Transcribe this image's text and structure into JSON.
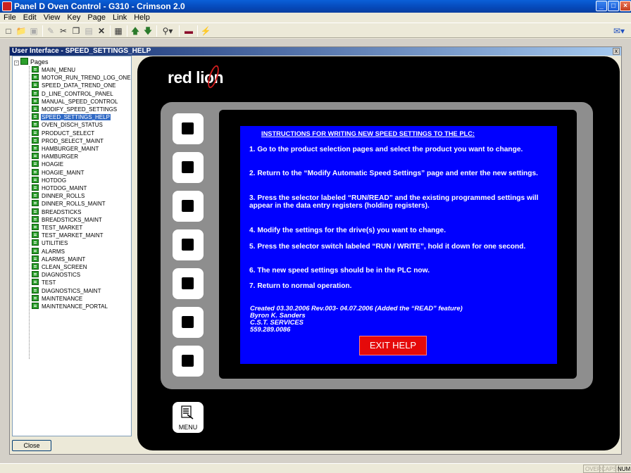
{
  "window": {
    "title": "Panel D Oven Control - G310 - Crimson 2.0",
    "controls": {
      "minimize": "_",
      "maximize": "□",
      "close": "×"
    }
  },
  "menubar": [
    "File",
    "Edit",
    "View",
    "Key",
    "Page",
    "Link",
    "Help"
  ],
  "toolbar": {
    "buttons": [
      "new-icon",
      "open-icon",
      "save-icon",
      "edit-icon",
      "cut-icon",
      "copy-icon",
      "paste-icon",
      "delete-icon",
      "panel-icon",
      "up-arrow-icon",
      "down-arrow-icon",
      "zoom-icon",
      "screen-icon",
      "lightning-icon"
    ]
  },
  "mdi": {
    "title": "User Interface - SPEED_SETTINGS_HELP",
    "close_label": "x"
  },
  "tree": {
    "root": "Pages",
    "selected": "SPEED_SETTINGS_HELP",
    "items": [
      "MAIN_MENU",
      "MOTOR_RUN_TREND_LOG_ONE",
      "SPEED_DATA_TREND_ONE",
      "D_LINE_CONTROL_PANEL",
      "MANUAL_SPEED_CONTROL",
      "MODIFY_SPEED_SETTINGS",
      "SPEED_SETTINGS_HELP",
      "OVEN_DISCH_STATUS",
      "PRODUCT_SELECT",
      "PROD_SELECT_MAINT",
      "HAMBURGER_MAINT",
      "HAMBURGER",
      "HOAGIE",
      "HOAGIE_MAINT",
      "HOTDOG",
      "HOTDOG_MAINT",
      "DINNER_ROLLS",
      "DINNER_ROLLS_MAINT",
      "BREADSTICKS",
      "BREADSTICKS_MAINT",
      "TEST_MARKET",
      "TEST_MARKET_MAINT",
      "UTILITIES",
      "ALARMS",
      "ALARMS_MAINT",
      "CLEAN_SCREEN",
      "DIAGNOSTICS",
      "TEST",
      "DIAGNOSTICS_MAINT",
      "MAINTENANCE",
      "MAINTENANCE_PORTAL"
    ]
  },
  "close_button": "Close",
  "device": {
    "brand": "red lion",
    "menu_label": "MENU",
    "screen": {
      "heading": "INSTRUCTIONS FOR WRITING NEW SPEED SETTINGS TO THE PLC:",
      "steps": [
        "1. Go to the product selection pages and select the product you want to change.",
        "2. Return to the “Modify Automatic Speed Settings” page and enter the new settings.",
        "3. Press the selector labeled “RUN/READ” and the existing programmed settings will appear in the data entry registers (holding registers).",
        "4. Modify the settings for the drive(s) you want to change.",
        "5. Press the selector switch labeled “RUN / WRITE”, hold it down for one second.",
        "6. The new speed settings should be in the PLC now.",
        "7. Return to normal operation."
      ],
      "credits": [
        "Created 03.30.2006  Rev.003- 04.07.2006 (Added the “READ” feature)",
        "Byron K. Sanders",
        "C.S.T. SERVICES",
        "559.289.0086"
      ],
      "exit_button": "EXIT HELP"
    }
  },
  "statusbar": {
    "over": "OVER",
    "caps": "CAPS",
    "num": "NUM"
  },
  "colors": {
    "screen_bg": "#0000ff",
    "exit_button": "#e50a0a",
    "selection": "#316ac5"
  }
}
